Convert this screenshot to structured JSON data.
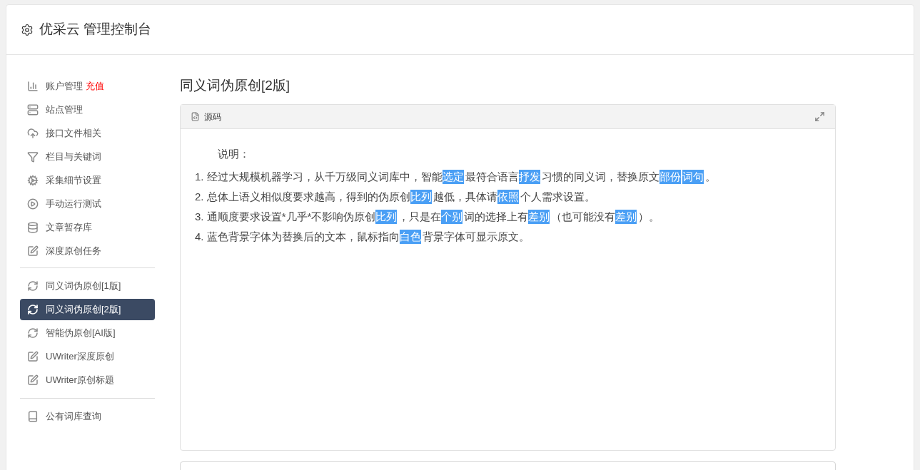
{
  "header": {
    "title": "优采云 管理控制台"
  },
  "sidebar": {
    "groups": [
      {
        "items": [
          {
            "label": "账户管理",
            "badge": "充值",
            "selected": false
          },
          {
            "label": "站点管理",
            "selected": false
          },
          {
            "label": "接口文件相关",
            "selected": false
          },
          {
            "label": "栏目与关键词",
            "selected": false
          },
          {
            "label": "采集细节设置",
            "selected": false
          },
          {
            "label": "手动运行测试",
            "selected": false
          },
          {
            "label": "文章暂存库",
            "selected": false
          },
          {
            "label": "深度原创任务",
            "selected": false
          }
        ]
      },
      {
        "items": [
          {
            "label": "同义词伪原创[1版]",
            "selected": false
          },
          {
            "label": "同义词伪原创[2版]",
            "selected": true
          },
          {
            "label": "智能伪原创[AI版]",
            "selected": false
          },
          {
            "label": "UWriter深度原创",
            "selected": false
          },
          {
            "label": "UWriter原创标题",
            "selected": false
          }
        ]
      },
      {
        "items": [
          {
            "label": "公有词库查询",
            "selected": false
          }
        ]
      }
    ]
  },
  "main": {
    "title": "同义词伪原创[2版]",
    "panel": {
      "tab": "源码",
      "heading": "说明：",
      "lines": [
        [
          {
            "text": "1. 经过大规模机器学习，从千万级同义词库中，智能",
            "highlighted": false
          },
          {
            "text": "选定",
            "highlighted": true
          },
          {
            "text": "最符合语言",
            "highlighted": false
          },
          {
            "text": "抒发",
            "highlighted": true
          },
          {
            "text": "习惯的同义词，替换原文",
            "highlighted": false
          },
          {
            "text": "部份",
            "highlighted": true
          },
          {
            "text": "词句",
            "highlighted": true
          },
          {
            "text": "。",
            "highlighted": false
          }
        ],
        [
          {
            "text": "2. 总体上语义相似度要求越高，得到的伪原创",
            "highlighted": false
          },
          {
            "text": "比列",
            "highlighted": true
          },
          {
            "text": "越低，具体请",
            "highlighted": false
          },
          {
            "text": "依照",
            "highlighted": true
          },
          {
            "text": "个人需求设置。",
            "highlighted": false
          }
        ],
        [
          {
            "text": "3. 通顺度要求设置*几乎*不影响伪原创",
            "highlighted": false
          },
          {
            "text": "比列",
            "highlighted": true
          },
          {
            "text": "，只是在",
            "highlighted": false
          },
          {
            "text": "个别",
            "highlighted": true
          },
          {
            "text": "词的选择上有",
            "highlighted": false
          },
          {
            "text": "差别",
            "highlighted": true
          },
          {
            "text": "（也可能没有",
            "highlighted": false
          },
          {
            "text": "差别",
            "highlighted": true
          },
          {
            "text": "）。",
            "highlighted": false
          }
        ],
        [
          {
            "text": "4. 蓝色背景字体为替换后的文本，鼠标指向",
            "highlighted": false
          },
          {
            "text": "白色",
            "highlighted": true
          },
          {
            "text": "背景字体可显示原文。",
            "highlighted": false
          }
        ]
      ]
    }
  }
}
